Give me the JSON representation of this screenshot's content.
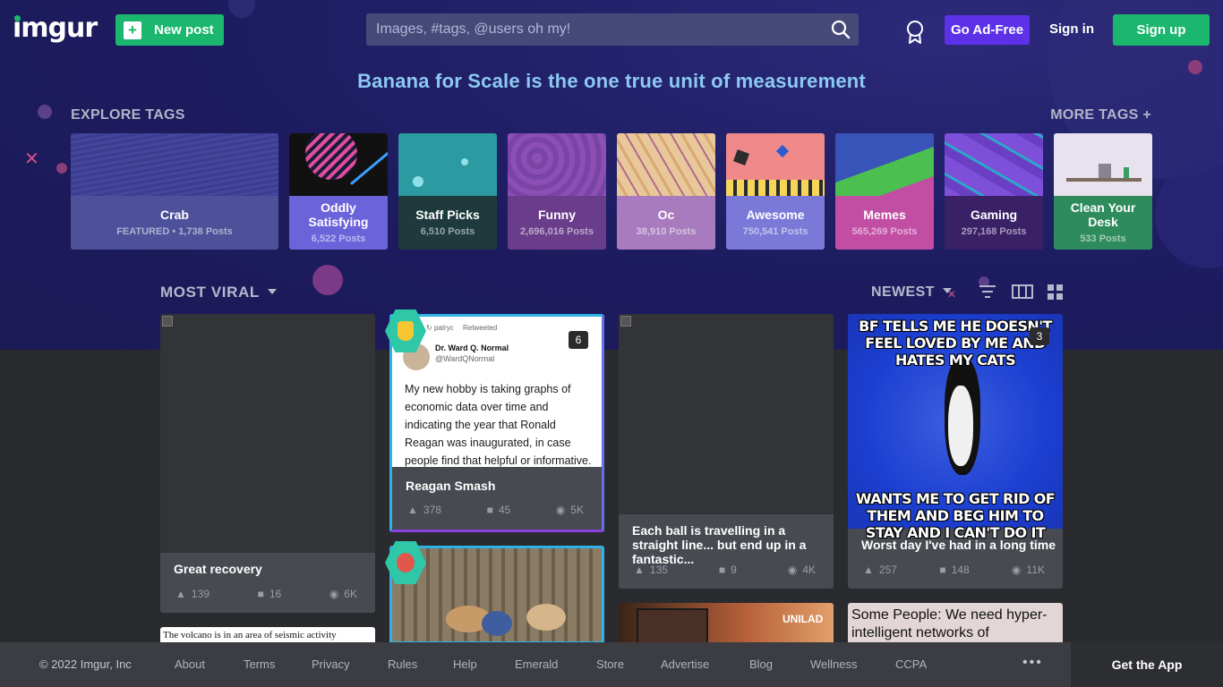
{
  "header": {
    "logo": "imgur",
    "new_post_label": "New post",
    "search_placeholder": "Images, #tags, @users oh my!",
    "go_ad_free_label": "Go Ad-Free",
    "sign_in_label": "Sign in",
    "sign_up_label": "Sign up"
  },
  "tagline": "Banana for Scale is the one true unit of measurement",
  "explore": {
    "heading": "EXPLORE TAGS",
    "more_label": "MORE TAGS +",
    "tags": [
      {
        "name": "Crab",
        "count": "FEATURED • 1,738 Posts",
        "color": "#4d5199"
      },
      {
        "name": "Oddly Satisfying",
        "count": "6,522 Posts",
        "color": "#6b63d9"
      },
      {
        "name": "Staff Picks",
        "count": "6,510 Posts",
        "color": "#1e3a3d"
      },
      {
        "name": "Funny",
        "count": "2,696,016 Posts",
        "color": "#6a3d8a"
      },
      {
        "name": "Oc",
        "count": "38,910 Posts",
        "color": "#a77bbd"
      },
      {
        "name": "Awesome",
        "count": "750,541 Posts",
        "color": "#7a79d8"
      },
      {
        "name": "Memes",
        "count": "565,269 Posts",
        "color": "#c14ea3"
      },
      {
        "name": "Gaming",
        "count": "297,168 Posts",
        "color": "#3a2166"
      },
      {
        "name": "Clean Your Desk",
        "count": "533 Posts",
        "color": "#2e8c5c"
      }
    ]
  },
  "feed": {
    "sort_label": "MOST VIRAL",
    "order_label": "NEWEST",
    "posts": [
      {
        "title": "Great recovery",
        "upvotes": "139",
        "comments": "16",
        "views": "6K"
      },
      {
        "title": "Reagan Smash",
        "upvotes": "378",
        "comments": "45",
        "views": "5K",
        "image_count": "6",
        "tweet_retweeted_by": "patryc",
        "tweet_retweeted_label": "Retweeted",
        "tweet_author": "Dr. Ward Q. Normal",
        "tweet_handle": "@WardQNormal",
        "tweet_text": "My new hobby is taking graphs of economic data over time and indicating the year that Ronald Reagan was inaugurated, in case people find that helpful or informative."
      },
      {
        "title": "Each ball is travelling in a straight line... but end up in a fantastic...",
        "upvotes": "135",
        "comments": "9",
        "views": "4K"
      },
      {
        "title": "Worst day I've had in a long time",
        "upvotes": "257",
        "comments": "148",
        "views": "11K",
        "image_count": "3",
        "meme_top": "BF TELLS ME HE DOESN'T FEEL LOVED BY ME AND HATES MY CATS",
        "meme_bottom": "WANTS ME TO GET RID OF THEM AND BEG HIM TO STAY AND I CAN'T DO IT"
      }
    ],
    "partial_text_1": "The volcano is in an area of seismic activity",
    "partial_text_2": "UNILAD",
    "partial_text_3": "Some People: We need hyper-intelligent networks of"
  },
  "footer": {
    "copyright": "© 2022 Imgur, Inc",
    "links": [
      "About",
      "Terms",
      "Privacy",
      "Rules",
      "Help",
      "Emerald",
      "Store",
      "Advertise",
      "Blog",
      "Wellness",
      "CCPA"
    ],
    "more": "•••",
    "get_app": "Get the App"
  },
  "colors": {
    "accent_green": "#1bb76e",
    "adfree_purple": "#5c31e8",
    "hero_bg": "#1d1b5e",
    "tagline_blue": "#8cc9f2"
  }
}
